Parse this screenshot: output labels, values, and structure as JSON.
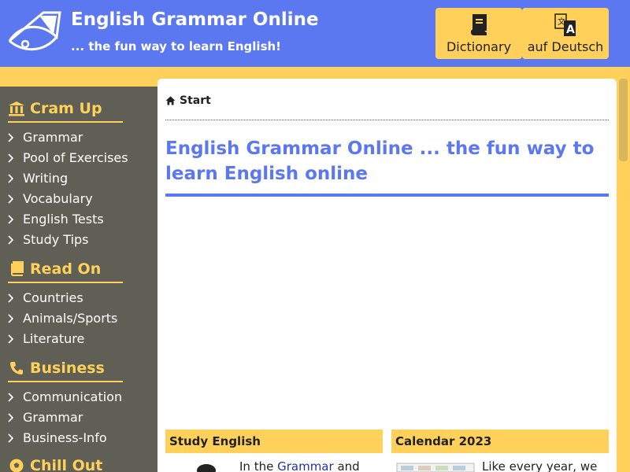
{
  "header": {
    "title": "English Grammar Online",
    "tagline": "... the fun way to learn English!",
    "buttons": {
      "dictionary": "Dictionary",
      "german": "auf Deutsch"
    }
  },
  "sidebar": {
    "sections": [
      {
        "title": "Cram Up",
        "icon": "bank-icon",
        "items": [
          "Grammar",
          "Pool of Exercises",
          "Writing",
          "Vocabulary",
          "English Tests",
          "Study Tips"
        ]
      },
      {
        "title": "Read On",
        "icon": "book-icon",
        "items": [
          "Countries",
          "Animals/Sports",
          "Literature"
        ]
      },
      {
        "title": "Business",
        "icon": "phone-icon",
        "items": [
          "Communication",
          "Grammar",
          "Business-Info"
        ]
      },
      {
        "title": "Chill Out",
        "icon": "soccer-ball-icon",
        "items": []
      }
    ]
  },
  "main": {
    "breadcrumb": "Start",
    "title": "English Grammar Online ... the fun way to learn English online",
    "cards": [
      {
        "title": "Study English",
        "text_prefix": "In the ",
        "link": "Grammar",
        "text_suffix": " and"
      },
      {
        "title": "Calendar 2023",
        "text": "Like every year, we"
      }
    ]
  },
  "colors": {
    "header_blue": "#5b78f0",
    "accent_yellow": "#ffd15a",
    "sidebar_gray": "#5f5f55"
  }
}
